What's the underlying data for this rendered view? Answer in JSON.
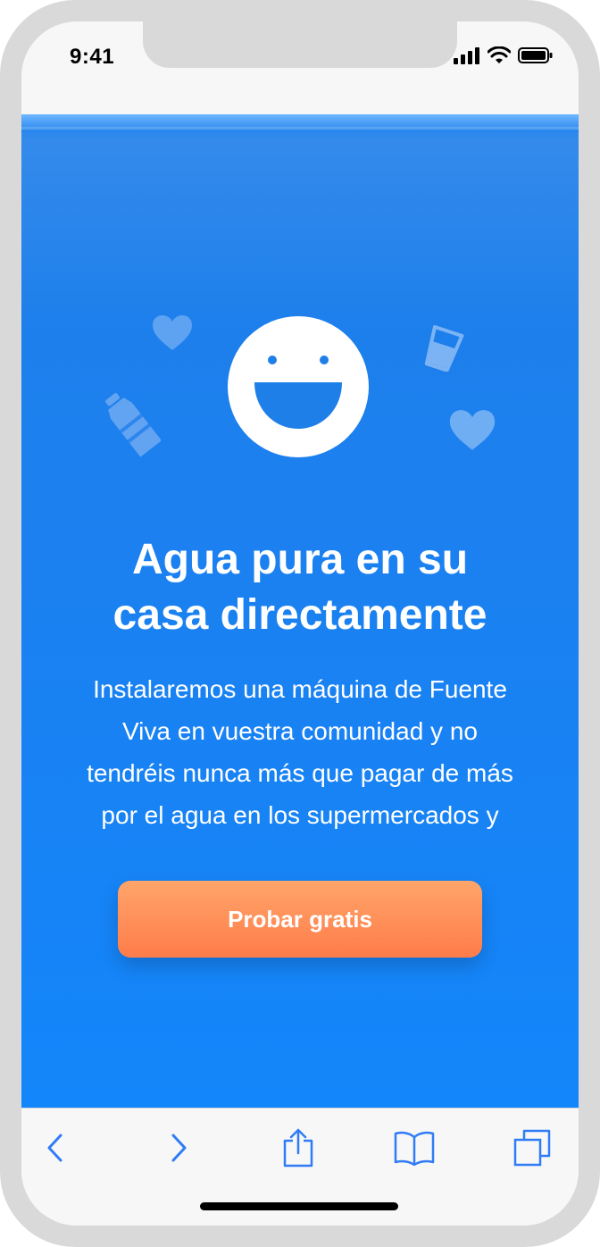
{
  "status_bar": {
    "time": "9:41",
    "icons": [
      "signal-icon",
      "wifi-icon",
      "battery-icon"
    ]
  },
  "hero": {
    "title_lines": [
      "Agua pura en su",
      "casa directamente"
    ],
    "description_lines": [
      "Instalaremos una máquina de Fuente",
      "Viva en vuestra comunidad y no",
      "tendréis nunca más que pagar de más",
      "por el agua en los supermercados y"
    ],
    "cta_label": "Probar gratis",
    "decorations": [
      "heart-icon",
      "water-glass-icon",
      "bottle-icon",
      "heart-icon",
      "smiley-face-icon"
    ]
  },
  "toolbar": {
    "items": [
      "back-icon",
      "forward-icon",
      "share-icon",
      "bookmarks-icon",
      "tabs-icon"
    ]
  },
  "colors": {
    "water_blue": "#1c80ef",
    "cta_orange_top": "#ffa56a",
    "cta_orange_bottom": "#ff7c4a",
    "ios_blue": "#2f7cf6"
  }
}
